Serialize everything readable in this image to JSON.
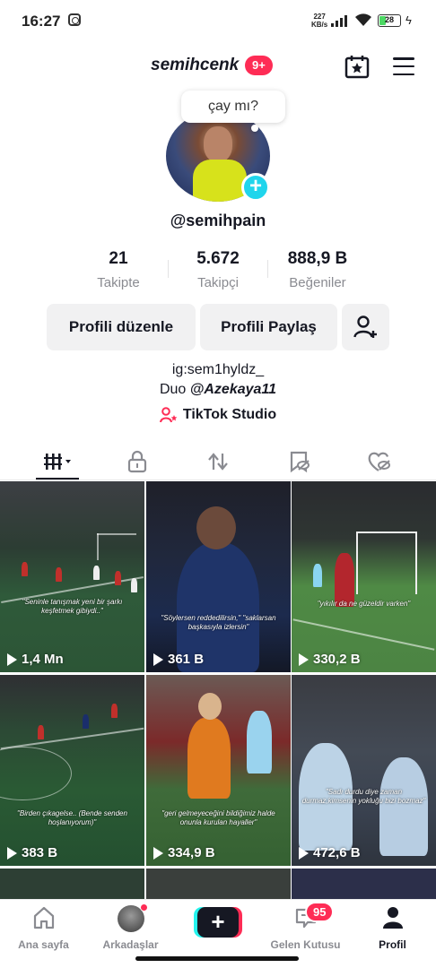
{
  "statusbar": {
    "time": "16:27",
    "speed_value": "227",
    "speed_unit": "KB/s",
    "battery": "28",
    "battery_level": 0.28
  },
  "header": {
    "username": "semihcenk",
    "notifications_badge": "9+"
  },
  "profile": {
    "note": "çay mı?",
    "handle": "@semihpain",
    "stats": [
      {
        "value": "21",
        "label": "Takipte"
      },
      {
        "value": "5.672",
        "label": "Takipçi"
      },
      {
        "value": "888,9 B",
        "label": "Beğeniler"
      }
    ],
    "edit_button": "Profili düzenle",
    "share_button": "Profili Paylaş",
    "bio_line1": "ig:sem1hyldz_",
    "bio_duo_prefix": "Duo ",
    "bio_mention": "@Azekaya11",
    "studio_label": "TikTok Studio"
  },
  "videos": [
    {
      "views": "1,4 Mn",
      "caption": "\"Seninle tanışmak yeni bir şarkı keşfetmek gibiydi..\""
    },
    {
      "views": "361 B",
      "caption": "\"Söylersen reddedilirsin,\" \"saklarsan başkasıyla izlersin\""
    },
    {
      "views": "330,2 B",
      "caption": "\"yıkılır da ne güzeldir varken\""
    },
    {
      "views": "383 B",
      "caption": "\"Birden çıkagelse.. (Bende senden hoşlanıyorum)\""
    },
    {
      "views": "334,9 B",
      "caption": "\"geri gelmeyeceğini bildiğimiz halde onunla kurulan hayaller\""
    },
    {
      "views": "472,6 B",
      "caption": "\"Sadı durdu diye zaman durmaz,kimsenin yokluğu bizi bozmaz\""
    }
  ],
  "bottomnav": {
    "home": "Ana sayfa",
    "friends": "Arkadaşlar",
    "inbox": "Gelen Kutusu",
    "inbox_badge": "95",
    "profile": "Profil"
  },
  "colors": {
    "accent": "#fe2c55",
    "cyan": "#20d5ec",
    "text": "#161823",
    "secondary": "#8a8b91"
  }
}
